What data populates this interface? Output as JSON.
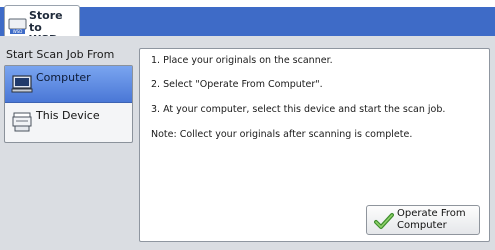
{
  "tab": {
    "label": "Store to\nWSD",
    "icon": "wsd-scanner-icon"
  },
  "left": {
    "title": "Start Scan Job From",
    "options": [
      {
        "label": "Computer",
        "icon": "computer-icon",
        "selected": true
      },
      {
        "label": "This Device",
        "icon": "copier-device-icon",
        "selected": false
      }
    ]
  },
  "instructions": {
    "line1": "1. Place your originals on the scanner.",
    "line2": "2. Select \"Operate From Computer\".",
    "line3": "3. At your computer, select this device and start the scan job.",
    "line4": "Note: Collect your originals after scanning is complete."
  },
  "button": {
    "label": "Operate From\nComputer",
    "icon": "checkmark-icon"
  },
  "colors": {
    "header": "#3e6bc7",
    "selected": "#5a86e0",
    "background": "#dadde2"
  }
}
